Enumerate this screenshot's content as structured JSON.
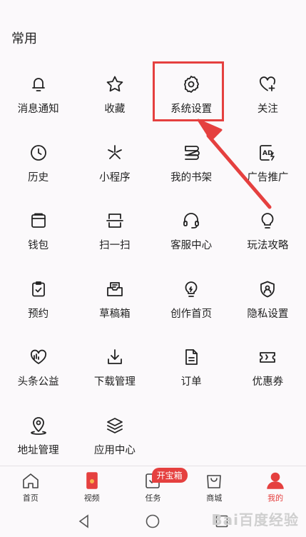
{
  "section": {
    "title": "常用"
  },
  "grid": [
    {
      "label": "消息通知",
      "icon": "bell-icon"
    },
    {
      "label": "收藏",
      "icon": "star-icon"
    },
    {
      "label": "系统设置",
      "icon": "gear-icon"
    },
    {
      "label": "关注",
      "icon": "heart-plus-icon"
    },
    {
      "label": "历史",
      "icon": "clock-icon"
    },
    {
      "label": "小程序",
      "icon": "spark-icon"
    },
    {
      "label": "我的书架",
      "icon": "bookshelf-icon"
    },
    {
      "label": "广告推广",
      "icon": "ad-icon"
    },
    {
      "label": "钱包",
      "icon": "wallet-icon"
    },
    {
      "label": "扫一扫",
      "icon": "scan-icon"
    },
    {
      "label": "客服中心",
      "icon": "headset-icon"
    },
    {
      "label": "玩法攻略",
      "icon": "bulb-icon"
    },
    {
      "label": "预约",
      "icon": "clipboard-check-icon"
    },
    {
      "label": "草稿箱",
      "icon": "draft-box-icon"
    },
    {
      "label": "创作首页",
      "icon": "creator-bulb-icon"
    },
    {
      "label": "隐私设置",
      "icon": "privacy-shield-icon"
    },
    {
      "label": "头条公益",
      "icon": "charity-heart-icon"
    },
    {
      "label": "下载管理",
      "icon": "download-icon"
    },
    {
      "label": "订单",
      "icon": "order-doc-icon"
    },
    {
      "label": "优惠券",
      "icon": "coupon-icon"
    },
    {
      "label": "地址管理",
      "icon": "location-pin-icon"
    },
    {
      "label": "应用中心",
      "icon": "layers-icon"
    }
  ],
  "bottom_nav": [
    {
      "label": "首页",
      "icon": "home-icon"
    },
    {
      "label": "视频",
      "icon": "video-icon"
    },
    {
      "label": "任务",
      "icon": "task-icon",
      "badge": "开宝箱"
    },
    {
      "label": "商城",
      "icon": "shopping-bag-icon"
    },
    {
      "label": "我的",
      "icon": "user-icon",
      "active": true
    }
  ],
  "colors": {
    "accent": "#e5403f",
    "text": "#222222",
    "background": "#fbf9fb"
  },
  "watermark": "Bai百度经验"
}
